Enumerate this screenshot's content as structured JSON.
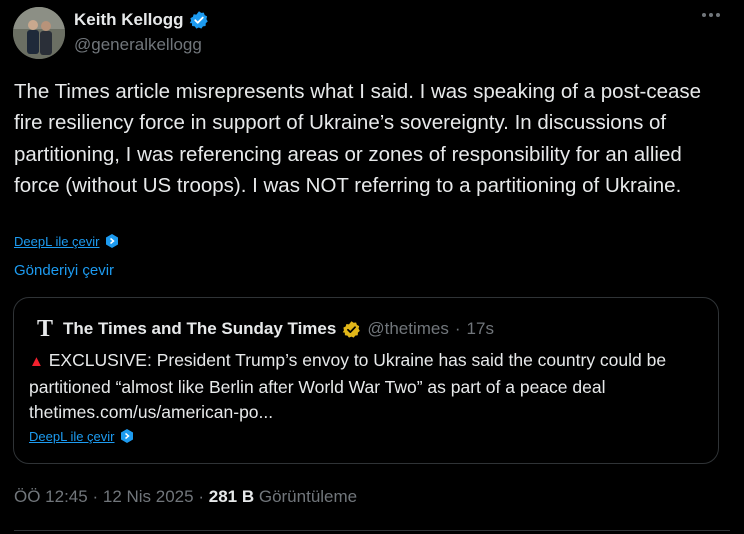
{
  "author": {
    "name": "Keith Kellogg",
    "handle": "@generalkellogg",
    "verified_color": "#1d9bf0"
  },
  "tweet": {
    "text": "The Times article misrepresents what I said. I was speaking of a post-cease fire resiliency force in support of Ukraine’s sovereignty. In discussions of partitioning, I was referencing areas or zones of responsibility for an allied force (without US troops). I was NOT referring to a partitioning of Ukraine.",
    "deepl_label": "DeepL ile çevir",
    "translate_label": "Gönderiyi çevir"
  },
  "quote": {
    "logo_letter": "T",
    "name": "The Times and The Sunday Times",
    "handle": "@thetimes",
    "separator": "·",
    "time": "17s",
    "verified_color": "#e2b719",
    "marker": "▲",
    "text": "EXCLUSIVE: President Trump’s envoy to Ukraine has said the country could be partitioned “almost like Berlin after World War Two” as part of a peace deal thetimes.com/us/american-po...",
    "deepl_label": "DeepL ile çevir"
  },
  "meta": {
    "time": "ÖÖ 12:45",
    "sep1": "·",
    "date": "12 Nis 2025",
    "sep2": "·",
    "views_count": "281 B",
    "views_label": "Görüntüleme"
  },
  "icons": {
    "verified": "verified-badge-icon",
    "gold_verified": "gold-verified-badge-icon",
    "deepl": "deepl-icon",
    "more": "more-icon"
  }
}
